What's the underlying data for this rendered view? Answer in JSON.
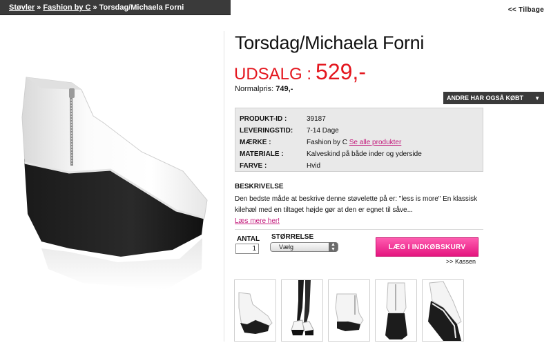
{
  "breadcrumb": {
    "items": [
      "Støvler",
      "Fashion by C"
    ],
    "separator": "»",
    "current": "Torsdag/Michaela Forni"
  },
  "back_link": "<< Tilbage",
  "product": {
    "title": "Torsdag/Michaela Forni",
    "sale_label": "UDSALG :",
    "sale_price": "529,-",
    "normal_price_label": "Normalpris:",
    "normal_price": "749,-"
  },
  "also_bought": {
    "label": "ANDRE HAR OGSÅ KØBT"
  },
  "specs": {
    "product_id_label": "PRODUKT-ID :",
    "product_id": "39187",
    "delivery_label": "LEVERINGSTID:",
    "delivery": "7-14 Dage",
    "brand_label": "MÆRKE :",
    "brand": "Fashion by C",
    "brand_link": "Se alle produkter",
    "material_label": "MATERIALE :",
    "material": "Kalveskind på både inder og yderside",
    "color_label": "FARVE :",
    "color": "Hvid"
  },
  "description": {
    "heading": "BESKRIVELSE",
    "text": "Den bedste måde at beskrive denne støvelette på er: \"less is more\" En klassisk kilehæl med en tiltaget højde gør at den er egnet til såve...",
    "read_more": "Læs mere her!"
  },
  "purchase": {
    "qty_label": "ANTAL",
    "qty_value": "1",
    "size_label": "STØRRELSE",
    "size_selected": "Vælg",
    "cart_button": "LÆG I INDKØBSKURV",
    "checkout_link": ">> Kassen"
  },
  "colors": {
    "sale_red": "#e4161e",
    "link_pink": "#c2187a",
    "cart_pink": "#ff3d9a",
    "dark_bar": "#3a3a3a"
  },
  "thumbnails": [
    "boot-side-view",
    "boot-worn-legs",
    "boot-front-view",
    "boot-rear-view",
    "boot-sole-view"
  ]
}
